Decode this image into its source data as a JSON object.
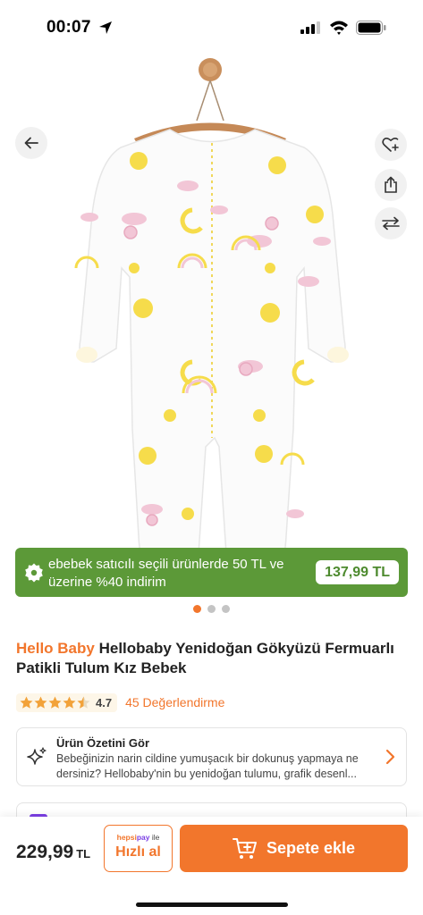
{
  "status_bar": {
    "time": "00:07"
  },
  "gallery": {
    "image_desc_icon": "baby-sleepsuit-image",
    "dots": 3,
    "active_dot": 0
  },
  "promo": {
    "text": "ebebek satıcılı seçili ürünlerde 50 TL ve üzerine %40 indirim",
    "price": "137,99 TL",
    "color": "#5c9938"
  },
  "product": {
    "brand": "Hello Baby",
    "name": "Hellobaby Yenidoğan Gökyüzü Fermuarlı Patikli Tulum Kız Bebek",
    "rating": "4.7",
    "rating_value": 4.7,
    "reviews": "45 Değerlendirme"
  },
  "summary": {
    "title": "Ürün Özetini Gör",
    "text": "Bebeğinizin narin cildine yumuşacık bir dokunuş yapmaya ne dersiniz?  Hellobaby'nin bu yenidoğan tulumu, grafik desenl..."
  },
  "bottom_bar": {
    "price": "229,99",
    "currency": "TL",
    "quick_brand_1": "hepsi",
    "quick_brand_2": "pay",
    "quick_brand_3": " ile",
    "quick_label": "Hızlı al",
    "add_to_cart": "Sepete ekle"
  },
  "colors": {
    "accent": "#f2762c",
    "promo_green": "#5c9938",
    "hepsipay_purple": "#7b3fe4"
  }
}
